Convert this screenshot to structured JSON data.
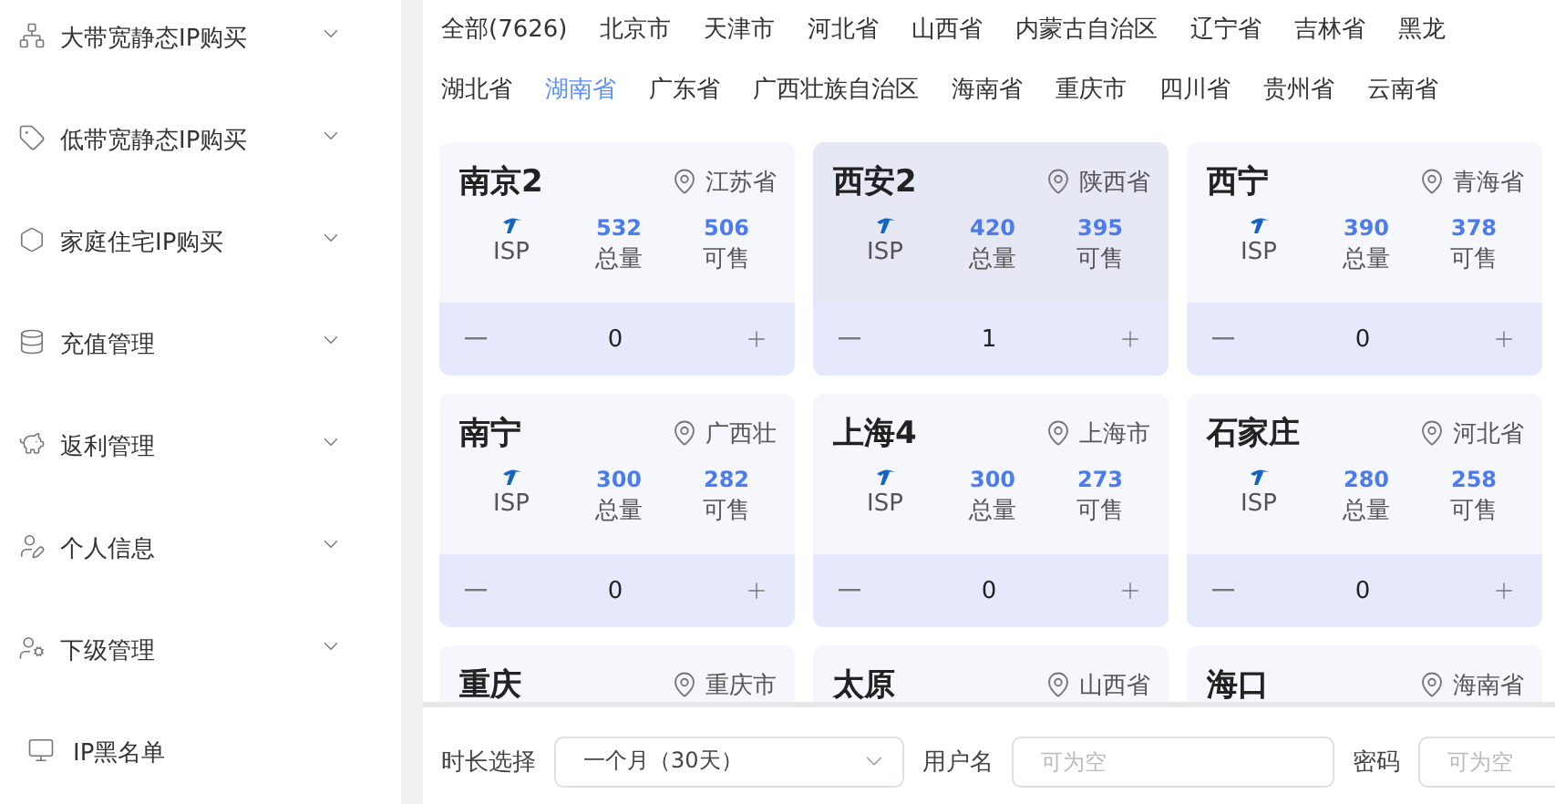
{
  "sidebar": {
    "items": [
      {
        "label": "大带宽静态IP购买",
        "kind": "group",
        "expanded": false
      },
      {
        "label": "低带宽静态IP购买",
        "kind": "group",
        "expanded": false
      },
      {
        "label": "家庭住宅IP购买",
        "kind": "group",
        "expanded": false
      },
      {
        "label": "充值管理",
        "kind": "group",
        "expanded": false
      },
      {
        "label": "返利管理",
        "kind": "group",
        "expanded": false
      },
      {
        "label": "个人信息",
        "kind": "group",
        "expanded": false
      },
      {
        "label": "下级管理",
        "kind": "group",
        "expanded": false
      },
      {
        "label": "IP黑名单",
        "kind": "link"
      }
    ]
  },
  "region_rows": [
    [
      {
        "label": "全部(7626)",
        "selected": false
      },
      {
        "label": "北京市",
        "selected": false
      },
      {
        "label": "天津市",
        "selected": false
      },
      {
        "label": "河北省",
        "selected": false
      },
      {
        "label": "山西省",
        "selected": false
      },
      {
        "label": "内蒙古自治区",
        "selected": false
      },
      {
        "label": "辽宁省",
        "selected": false
      },
      {
        "label": "吉林省",
        "selected": false
      },
      {
        "label": "黑龙",
        "selected": false
      }
    ],
    [
      {
        "label": "湖北省",
        "selected": false
      },
      {
        "label": "湖南省",
        "selected": true
      },
      {
        "label": "广东省",
        "selected": false
      },
      {
        "label": "广西壮族自治区",
        "selected": false
      },
      {
        "label": "海南省",
        "selected": false
      },
      {
        "label": "重庆市",
        "selected": false
      },
      {
        "label": "四川省",
        "selected": false
      },
      {
        "label": "贵州省",
        "selected": false
      },
      {
        "label": "云南省",
        "selected": false
      }
    ]
  ],
  "cards": [
    {
      "name": "南京2",
      "province": "江苏省",
      "isp": "ISP",
      "total": "532",
      "total_label": "总量",
      "available": "506",
      "available_label": "可售",
      "count": "0",
      "selected": false
    },
    {
      "name": "西安2",
      "province": "陕西省",
      "isp": "ISP",
      "total": "420",
      "total_label": "总量",
      "available": "395",
      "available_label": "可售",
      "count": "1",
      "selected": true
    },
    {
      "name": "西宁",
      "province": "青海省",
      "isp": "ISP",
      "total": "390",
      "total_label": "总量",
      "available": "378",
      "available_label": "可售",
      "count": "0",
      "selected": false
    },
    {
      "name": "南宁",
      "province": "广西壮",
      "isp": "ISP",
      "total": "300",
      "total_label": "总量",
      "available": "282",
      "available_label": "可售",
      "count": "0",
      "selected": false
    },
    {
      "name": "上海4",
      "province": "上海市",
      "isp": "ISP",
      "total": "300",
      "total_label": "总量",
      "available": "273",
      "available_label": "可售",
      "count": "0",
      "selected": false
    },
    {
      "name": "石家庄",
      "province": "河北省",
      "isp": "ISP",
      "total": "280",
      "total_label": "总量",
      "available": "258",
      "available_label": "可售",
      "count": "0",
      "selected": false
    },
    {
      "name": "重庆",
      "province": "重庆市"
    },
    {
      "name": "太原",
      "province": "山西省"
    },
    {
      "name": "海口",
      "province": "海南省"
    }
  ],
  "order_bar": {
    "duration_label": "时长选择",
    "duration_value": "一个月（30天）",
    "username_label": "用户名",
    "username_placeholder": "可为空",
    "password_label": "密码",
    "password_placeholder": "可为空"
  }
}
